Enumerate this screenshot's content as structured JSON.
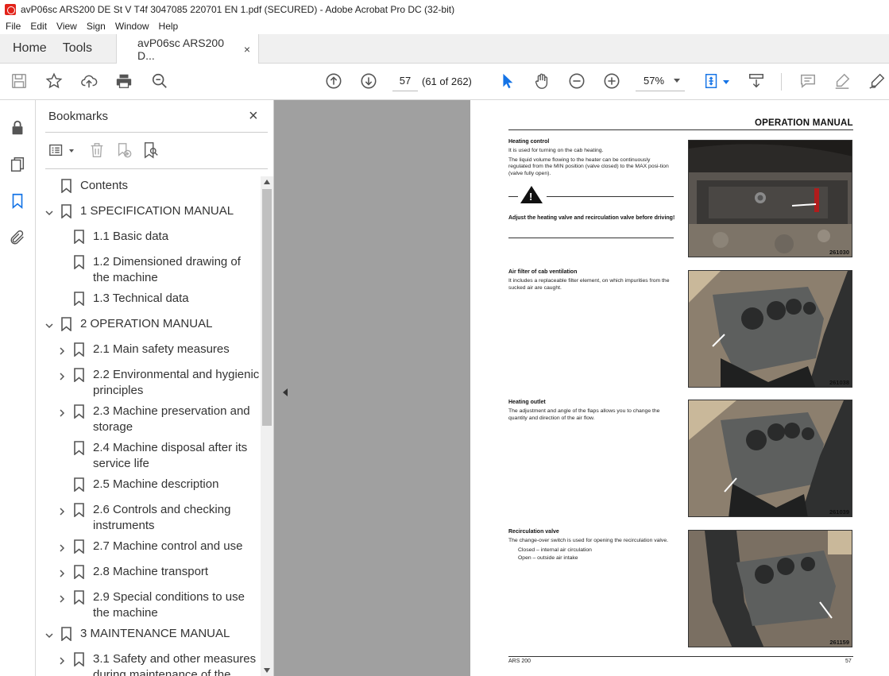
{
  "window": {
    "title": "avP06sc ARS200 DE St V T4f 3047085 220701 EN 1.pdf (SECURED) - Adobe Acrobat Pro DC (32-bit)"
  },
  "menu": [
    "File",
    "Edit",
    "View",
    "Sign",
    "Window",
    "Help"
  ],
  "tabs": {
    "home": "Home",
    "tools": "Tools",
    "document": "avP06sc ARS200 D...",
    "close": "×"
  },
  "toolbar": {
    "page_number": "57",
    "page_count": "(61 of 262)",
    "zoom": "57%",
    "icons": [
      "save-icon",
      "star-icon",
      "upload-icon",
      "print-icon",
      "search-zoom-icon",
      "prev-page-icon",
      "next-page-icon",
      "select-pointer-icon",
      "hand-icon",
      "zoom-out-icon",
      "zoom-in-icon",
      "fit-page-icon",
      "scroll-mode-icon",
      "comment-icon",
      "highlight-icon",
      "sign-icon"
    ]
  },
  "bookmarks": {
    "title": "Bookmarks",
    "close": "×",
    "items": [
      {
        "label": "Contents",
        "level": 0,
        "expander": "none"
      },
      {
        "label": "1 SPECIFICATION MANUAL",
        "level": 0,
        "expander": "expanded"
      },
      {
        "label": "1.1 Basic data",
        "level": 1,
        "expander": "none"
      },
      {
        "label": "1.2 Dimensioned drawing of",
        "label2": "the machine",
        "level": 1,
        "expander": "none"
      },
      {
        "label": "1.3 Technical data",
        "level": 1,
        "expander": "none"
      },
      {
        "label": "2 OPERATION MANUAL",
        "level": 0,
        "expander": "expanded"
      },
      {
        "label": "2.1 Main safety measures",
        "level": 1,
        "expander": "collapsed"
      },
      {
        "label": "2.2 Environmental and hygienic",
        "label2": "principles",
        "level": 1,
        "expander": "collapsed"
      },
      {
        "label": "2.3 Machine preservation and",
        "label2": "storage",
        "level": 1,
        "expander": "collapsed"
      },
      {
        "label": "2.4 Machine disposal after its",
        "label2": "service life",
        "level": 1,
        "expander": "none"
      },
      {
        "label": "2.5 Machine description",
        "level": 1,
        "expander": "none"
      },
      {
        "label": "2.6 Controls and checking",
        "label2": "instruments",
        "level": 1,
        "expander": "collapsed"
      },
      {
        "label": "2.7 Machine control and use",
        "level": 1,
        "expander": "collapsed"
      },
      {
        "label": "2.8 Machine transport",
        "level": 1,
        "expander": "collapsed"
      },
      {
        "label": "2.9 Special conditions to use",
        "label2": "the machine",
        "level": 1,
        "expander": "collapsed"
      },
      {
        "label": "3 MAINTENANCE MANUAL",
        "level": 0,
        "expander": "expanded"
      },
      {
        "label": "3.1 Safety and other measures",
        "label2": "during maintenance of the",
        "level": 1,
        "expander": "collapsed"
      }
    ]
  },
  "page": {
    "header": "OPERATION MANUAL",
    "sections": [
      {
        "title": "Heating control",
        "paragraphs": [
          "It is used for turning on the cab heating.",
          "The liquid volume flowing to the heater can be continuously regulated from the MIN position (valve closed) to the MAX posi-tion (valve fully open)."
        ],
        "warning": "Adjust the heating valve and recirculation valve before driving!",
        "photo_code": "261030"
      },
      {
        "title": "Air filter of cab ventilation",
        "paragraphs": [
          "It includes a replaceable filter element, on which impurities from the sucked air are caught."
        ],
        "photo_code": "261038"
      },
      {
        "title": "Heating outlet",
        "paragraphs": [
          "The adjustment and angle of the flaps allows you to change the quantity and direction of the air flow."
        ],
        "photo_code": "261039"
      },
      {
        "title": "Recirculation valve",
        "paragraphs": [
          "The change-over switch is used for opening the recirculation valve."
        ],
        "list": [
          "Closed – internal air circulation",
          "Open – outside air intake"
        ],
        "photo_code": "261159"
      }
    ],
    "footer_left": "ARS 200",
    "footer_right": "57"
  }
}
